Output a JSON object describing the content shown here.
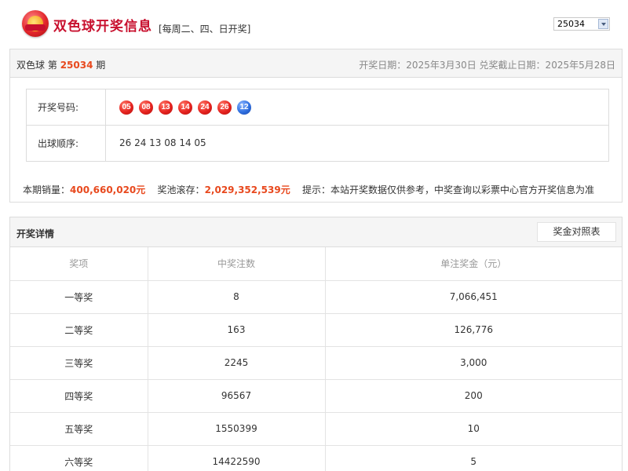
{
  "header": {
    "logo_icon": "lottery-ball-logo-icon",
    "title": "双色球开奖信息",
    "note": "[每周二、四、日开奖]",
    "issue_select_value": "25034"
  },
  "issue_info": {
    "game": "双色球",
    "prefix": "第",
    "number": "25034",
    "suffix": "期",
    "dates": "开奖日期：2025年3月30日 兑奖截止日期：2025年5月28日"
  },
  "draw": {
    "numbers_label": "开奖号码:",
    "red_balls": [
      "05",
      "08",
      "13",
      "14",
      "24",
      "26"
    ],
    "blue_balls": [
      "12"
    ],
    "order_label": "出球顺序:",
    "order_value": "26 24 13 08 14 05"
  },
  "sales": {
    "sales_label": "本期销量：",
    "sales_value": "400,660,020元",
    "pool_label": "奖池滚存：",
    "pool_value": "2,029,352,539元",
    "tip": "提示：本站开奖数据仅供参考，中奖查询以彩票中心官方开奖信息为准"
  },
  "details": {
    "title": "开奖详情",
    "compare_button": "奖金对照表",
    "columns": [
      "奖项",
      "中奖注数",
      "单注奖金（元）"
    ],
    "rows": [
      [
        "一等奖",
        "8",
        "7,066,451"
      ],
      [
        "二等奖",
        "163",
        "126,776"
      ],
      [
        "三等奖",
        "2245",
        "3,000"
      ],
      [
        "四等奖",
        "96567",
        "200"
      ],
      [
        "五等奖",
        "1550399",
        "10"
      ],
      [
        "六等奖",
        "14422590",
        "5"
      ]
    ]
  },
  "colors": {
    "brand_red": "#c8102e",
    "highlight_orange": "#e8491e",
    "red_ball": "#e6231f",
    "blue_ball": "#2f6fe0"
  }
}
